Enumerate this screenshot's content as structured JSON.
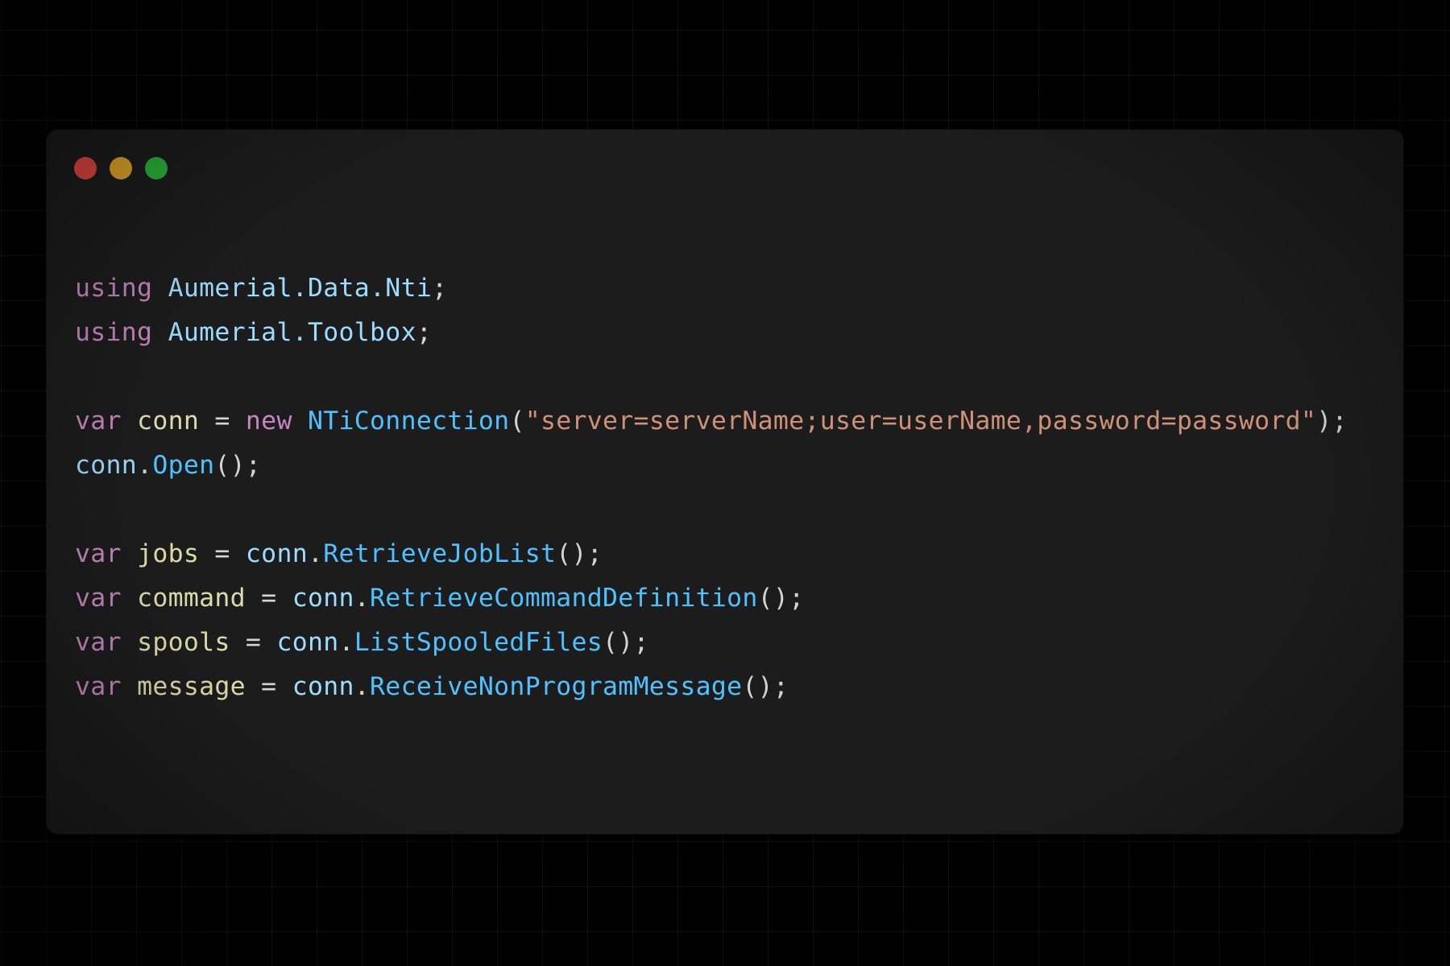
{
  "window": {
    "controls": {
      "close_color": "#e5483f",
      "minimize_color": "#e2a72a",
      "maximize_color": "#29b53a"
    }
  },
  "code": {
    "lines": [
      [
        {
          "t": "using",
          "k": "kw"
        },
        {
          "t": " ",
          "k": "punc"
        },
        {
          "t": "Aumerial.Data.Nti",
          "k": "ns"
        },
        {
          "t": ";",
          "k": "punc"
        }
      ],
      [
        {
          "t": "using",
          "k": "kw"
        },
        {
          "t": " ",
          "k": "punc"
        },
        {
          "t": "Aumerial.Toolbox",
          "k": "ns"
        },
        {
          "t": ";",
          "k": "punc"
        }
      ],
      [],
      [
        {
          "t": "var",
          "k": "kw"
        },
        {
          "t": " ",
          "k": "punc"
        },
        {
          "t": "conn",
          "k": "var"
        },
        {
          "t": " = ",
          "k": "punc"
        },
        {
          "t": "new",
          "k": "kw"
        },
        {
          "t": " ",
          "k": "punc"
        },
        {
          "t": "NTiConnection",
          "k": "fn"
        },
        {
          "t": "(",
          "k": "punc"
        },
        {
          "t": "\"server=serverName;user=userName,password=password\"",
          "k": "str"
        },
        {
          "t": ");",
          "k": "punc"
        }
      ],
      [
        {
          "t": "conn",
          "k": "obj"
        },
        {
          "t": ".",
          "k": "punc"
        },
        {
          "t": "Open",
          "k": "fn"
        },
        {
          "t": "();",
          "k": "punc"
        }
      ],
      [],
      [
        {
          "t": "var",
          "k": "kw"
        },
        {
          "t": " ",
          "k": "punc"
        },
        {
          "t": "jobs",
          "k": "var"
        },
        {
          "t": " = ",
          "k": "punc"
        },
        {
          "t": "conn",
          "k": "obj"
        },
        {
          "t": ".",
          "k": "punc"
        },
        {
          "t": "RetrieveJobList",
          "k": "fn"
        },
        {
          "t": "();",
          "k": "punc"
        }
      ],
      [
        {
          "t": "var",
          "k": "kw"
        },
        {
          "t": " ",
          "k": "punc"
        },
        {
          "t": "command",
          "k": "var"
        },
        {
          "t": " = ",
          "k": "punc"
        },
        {
          "t": "conn",
          "k": "obj"
        },
        {
          "t": ".",
          "k": "punc"
        },
        {
          "t": "RetrieveCommandDefinition",
          "k": "fn"
        },
        {
          "t": "();",
          "k": "punc"
        }
      ],
      [
        {
          "t": "var",
          "k": "kw"
        },
        {
          "t": " ",
          "k": "punc"
        },
        {
          "t": "spools",
          "k": "var"
        },
        {
          "t": " = ",
          "k": "punc"
        },
        {
          "t": "conn",
          "k": "obj"
        },
        {
          "t": ".",
          "k": "punc"
        },
        {
          "t": "ListSpooledFiles",
          "k": "fn"
        },
        {
          "t": "();",
          "k": "punc"
        }
      ],
      [
        {
          "t": "var",
          "k": "kw"
        },
        {
          "t": " ",
          "k": "punc"
        },
        {
          "t": "message",
          "k": "var"
        },
        {
          "t": " = ",
          "k": "punc"
        },
        {
          "t": "conn",
          "k": "obj"
        },
        {
          "t": ".",
          "k": "punc"
        },
        {
          "t": "ReceiveNonProgramMessage",
          "k": "fn"
        },
        {
          "t": "();",
          "k": "punc"
        }
      ]
    ]
  }
}
